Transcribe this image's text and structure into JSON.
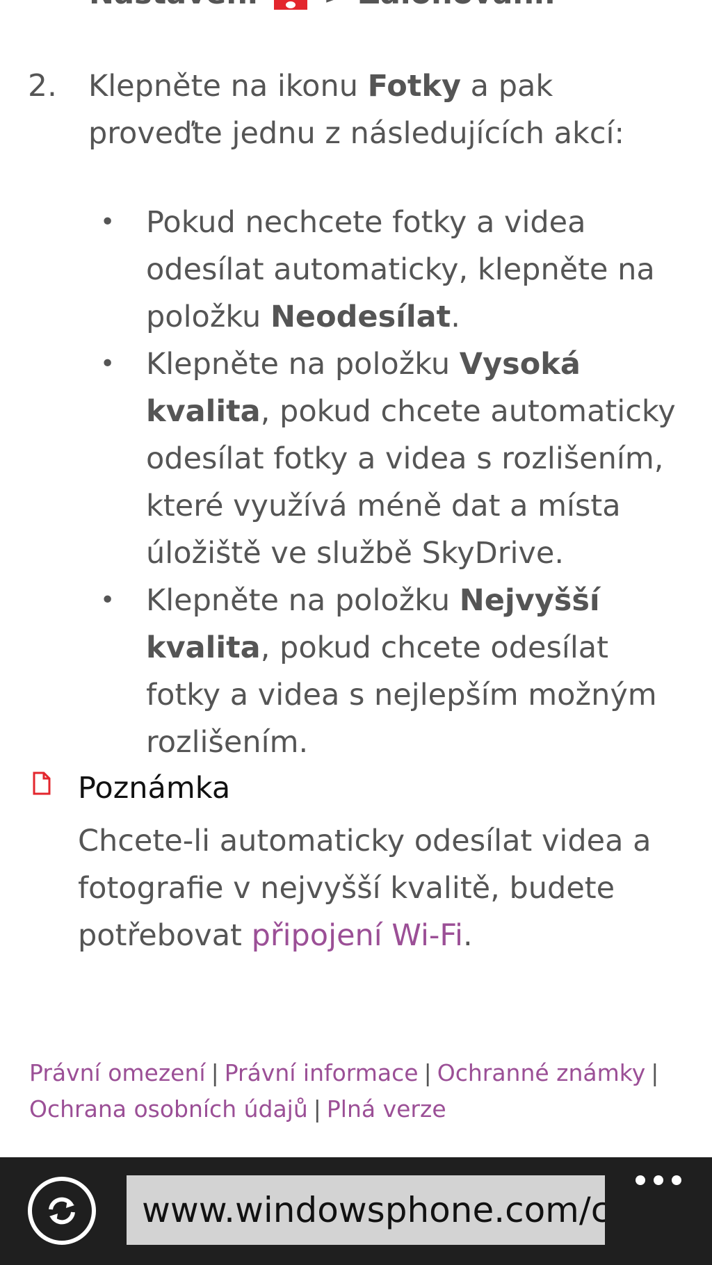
{
  "article": {
    "top_line_start": "Nastavení",
    "top_line_end": "> Zálohování.",
    "step": {
      "number": "2.",
      "text_before": "Klepněte na ikonu ",
      "bold": "Fotky",
      "text_after": " a pak proveďte jednu z následujících akcí:"
    },
    "bullets": [
      {
        "before": "Pokud nechcete fotky a videa odesílat automaticky, klepněte na položku ",
        "bold": "Neodesílat",
        "after": "."
      },
      {
        "before": "Klepněte na položku ",
        "bold": "Vysoká kvalita",
        "after": ", pokud chcete automaticky odesílat fotky a videa s rozlišením, které využívá méně dat a místa úložiště ve službě SkyDrive."
      },
      {
        "before": "Klepněte na položku ",
        "bold": "Nejvyšší kvalita",
        "after": ", pokud chcete odesílat fotky a videa s nejlepším možným rozlišením."
      }
    ],
    "note": {
      "title": "Poznámka",
      "text_before": "Chcete-li automaticky odesílat videa a fotografie v nejvyšší kvalitě, budete potřebovat ",
      "link": "připojení Wi-Fi",
      "text_after": "."
    }
  },
  "footer": {
    "links": [
      "Právní omezení",
      "Právní informace",
      "Ochranné známky",
      "Ochrana osobních údajů",
      "Plná verze"
    ],
    "separator": "|"
  },
  "browser_bar": {
    "url": "www.windowsphone.com/cs",
    "icons": {
      "refresh": "refresh-icon",
      "more": "more-dots-icon",
      "note": "note-document-icon",
      "settings": "settings-gear-icon"
    },
    "colors": {
      "bar": "#1f1f1f",
      "url_field": "#d3d3d3",
      "link": "#9b4f96",
      "accent": "#e3262d"
    }
  }
}
